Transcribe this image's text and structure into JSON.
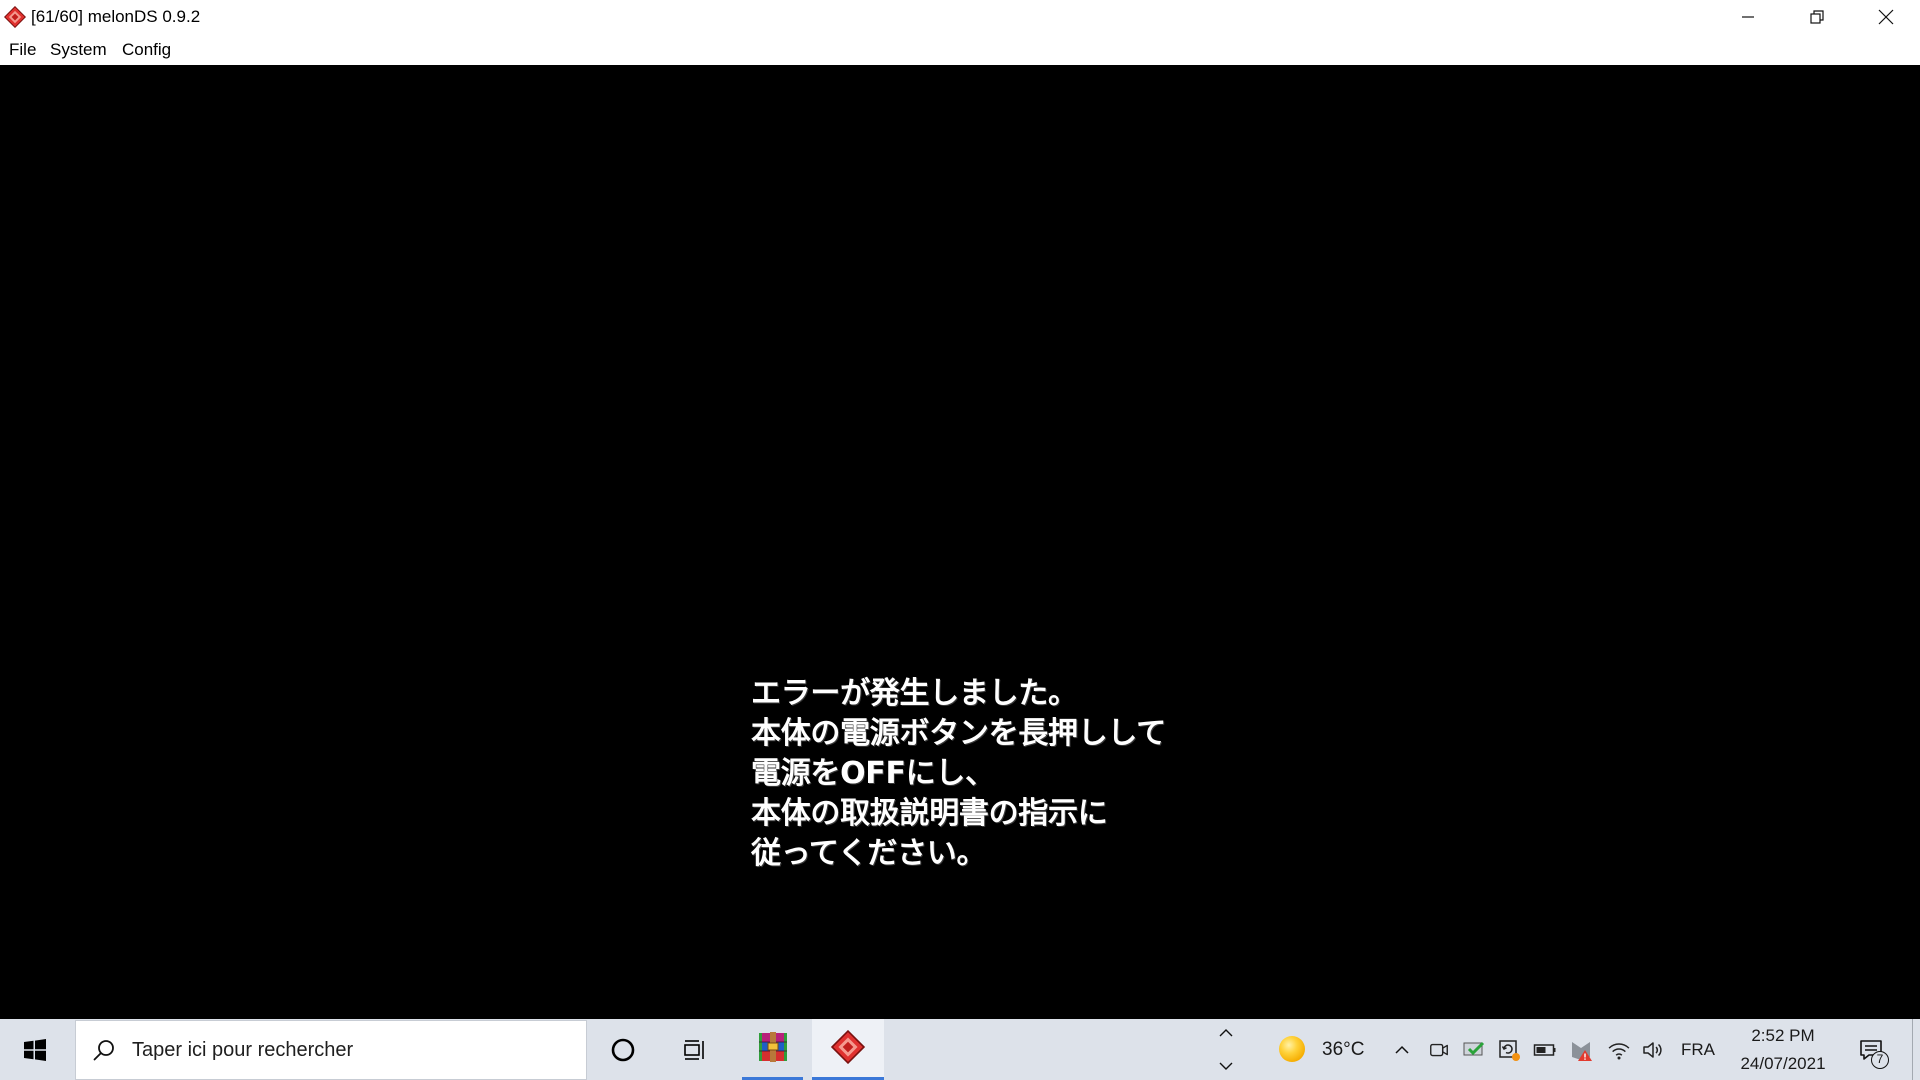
{
  "window": {
    "title": "[61/60] melonDS 0.9.2",
    "app_icon": "melonds-icon",
    "controls": [
      "minimize-icon",
      "restore-icon",
      "close-icon"
    ]
  },
  "menu": {
    "items": [
      "File",
      "System",
      "Config"
    ]
  },
  "screen": {
    "message_lines": [
      "エラーが発生しました。",
      "本体の電源ボタンを長押しして",
      "電源をOFFにし、",
      "本体の取扱説明書の指示に",
      "従ってください。"
    ]
  },
  "taskbar": {
    "start_icon": "windows-logo-icon",
    "search": {
      "icon": "search-icon",
      "placeholder": "Taper ici pour rechercher"
    },
    "cortana_icon": "cortana-icon",
    "task_view_icon": "task-view-icon",
    "apps": [
      {
        "icon": "winrar-icon",
        "running": true,
        "active": false
      },
      {
        "icon": "melonds-icon",
        "running": true,
        "active": true
      }
    ],
    "scroll_icons": [
      "chevron-up-icon",
      "chevron-down-icon"
    ],
    "weather": {
      "icon": "sun-icon",
      "temperature": "36°C"
    },
    "tray": {
      "overflow_icon": "chevron-up-icon",
      "icons": [
        "meet-now-icon",
        "windows-security-icon",
        "update-icon",
        "battery-icon",
        "antivirus-icon",
        "wifi-icon",
        "volume-icon"
      ],
      "language": "FRA"
    },
    "clock": {
      "time": "2:52 PM",
      "date": "24/07/2021"
    },
    "notifications": {
      "icon": "notification-icon",
      "count": "7"
    }
  },
  "colors": {
    "title_bar_bg": "#ffffff",
    "screen_bg": "#000000",
    "message_text": "#ffffff",
    "taskbar_bg": "#dde2ea",
    "search_bg": "#ffffff",
    "active_app_bg": "#eef1f6",
    "accent": "#3b78d8"
  }
}
